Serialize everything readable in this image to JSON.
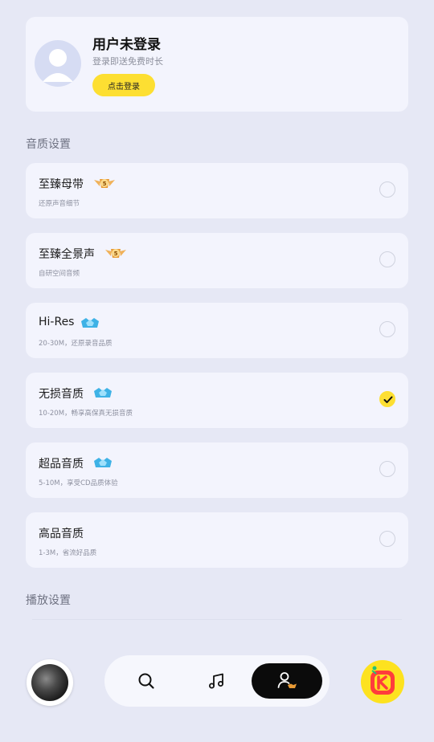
{
  "profile": {
    "title": "用户未登录",
    "subtitle": "登录即送免费时长",
    "login_label": "点击登录"
  },
  "quality_section_title": "音质设置",
  "quality_options": [
    {
      "name": "至臻母带",
      "desc": "还原声音细节",
      "badge": "svip-badge-icon",
      "selected": false
    },
    {
      "name": "至臻全景声",
      "desc": "自研空间音频",
      "badge": "svip-badge-icon",
      "selected": false
    },
    {
      "name": "Hi-Res",
      "desc": "20-30M，还原录音品质",
      "badge": "vip-badge-icon",
      "selected": false
    },
    {
      "name": "无损音质",
      "desc": "10-20M，畅享高保真无损音质",
      "badge": "vip-badge-icon",
      "selected": true
    },
    {
      "name": "超品音质",
      "desc": "5-10M，享受CD品质体验",
      "badge": "vip-badge-icon",
      "selected": false
    },
    {
      "name": "高品音质",
      "desc": "1-3M，省流好品质",
      "badge": "",
      "selected": false
    }
  ],
  "playback_section_title": "播放设置",
  "bottom_nav": {
    "items": [
      "search-icon",
      "music-note-icon",
      "user-profile-icon"
    ],
    "active_index": 2
  },
  "colors": {
    "accent": "#fddf32",
    "page_bg": "#e6e8f5",
    "card_bg": "#f3f4fd",
    "nav_active": "#0b0b0b"
  }
}
